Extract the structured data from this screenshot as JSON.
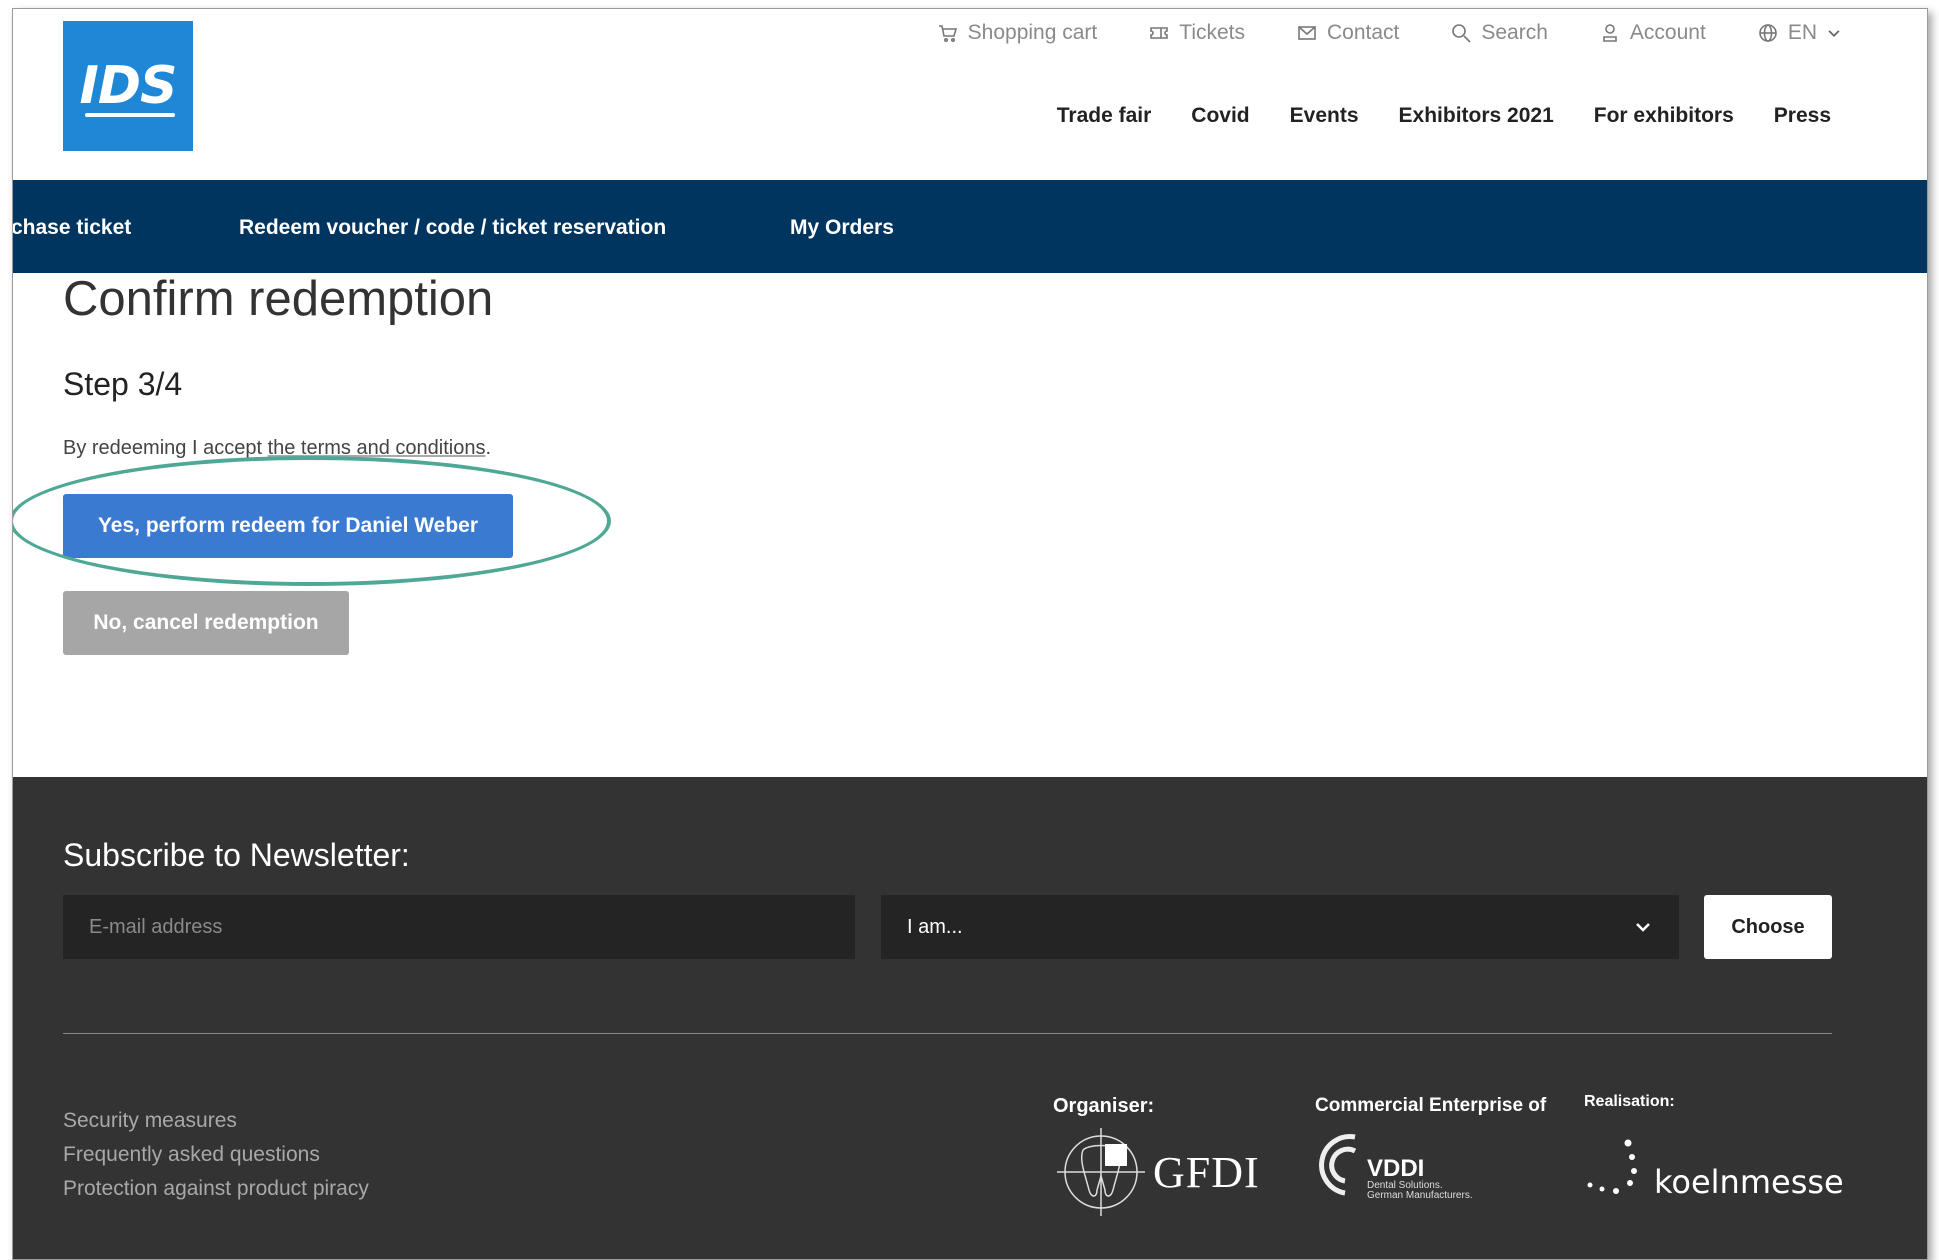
{
  "header": {
    "logo_text": "IDS",
    "utility_nav": [
      {
        "label": "Shopping cart",
        "icon": "cart-icon"
      },
      {
        "label": "Tickets",
        "icon": "ticket-icon"
      },
      {
        "label": "Contact",
        "icon": "mail-icon"
      },
      {
        "label": "Search",
        "icon": "search-icon"
      },
      {
        "label": "Account",
        "icon": "user-icon"
      },
      {
        "label": "EN",
        "icon": "globe-icon"
      }
    ],
    "main_nav": [
      "Trade fair",
      "Covid",
      "Events",
      "Exhibitors 2021",
      "For exhibitors",
      "Press"
    ]
  },
  "subnav": {
    "items": [
      "chase ticket",
      "Redeem voucher / code / ticket reservation",
      "My Orders"
    ]
  },
  "content": {
    "title": "Confirm redemption",
    "step": "Step 3/4",
    "terms_prefix": "By redeeming I accept ",
    "terms_link": "the terms and conditions",
    "terms_suffix": ".",
    "yes_button": "Yes, perform redeem for Daniel Weber",
    "no_button": "No, cancel redemption"
  },
  "footer": {
    "newsletter_title": "Subscribe to Newsletter:",
    "email_placeholder": "E-mail address",
    "role_select_value": "I am...",
    "choose_button": "Choose",
    "links": [
      "Security measures",
      "Frequently asked questions",
      "Protection against product piracy"
    ],
    "organiser_label": "Organiser:",
    "organiser_logo": "GFDI",
    "commercial_label": "Commercial Enterprise of",
    "commercial_logo": "VDDI",
    "commercial_tagline_1": "Dental Solutions.",
    "commercial_tagline_2": "German Manufacturers.",
    "realisation_label": "Realisation:",
    "realisation_logo": "koelnmesse"
  },
  "colors": {
    "brand_blue": "#1e88d6",
    "nav_bar": "#00355f",
    "primary_button": "#3a7ad0",
    "secondary_button": "#a6a6a6",
    "footer_bg": "#333333",
    "highlight": "#4fa896"
  }
}
